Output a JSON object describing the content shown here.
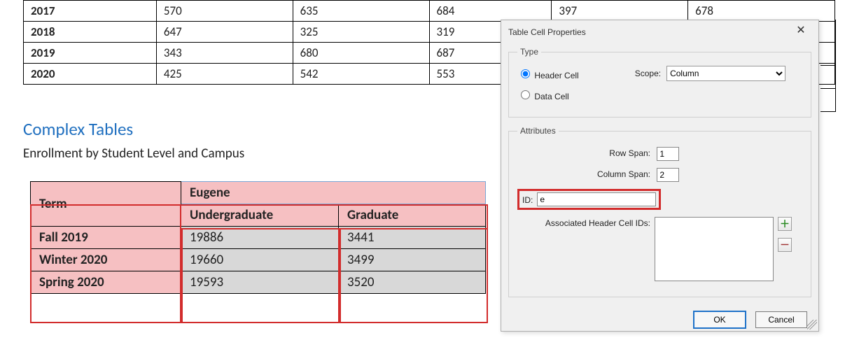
{
  "top_table": {
    "rows": [
      {
        "year": "2017",
        "a": "570",
        "b": "635",
        "c": "684",
        "d": "397",
        "e": "678"
      },
      {
        "year": "2018",
        "a": "647",
        "b": "325",
        "c": "319",
        "d": "",
        "e": ""
      },
      {
        "year": "2019",
        "a": "343",
        "b": "680",
        "c": "687",
        "d": "",
        "e": ""
      },
      {
        "year": "2020",
        "a": "425",
        "b": "542",
        "c": "553",
        "d": "",
        "e": ""
      }
    ]
  },
  "section_title": "Complex Tables",
  "section_caption": "Enrollment by Student Level and Campus",
  "cx_table": {
    "term_header": "Term",
    "campus_header": "Eugene",
    "sub_headers": {
      "ug": "Undergraduate",
      "gr": "Graduate"
    },
    "rows": [
      {
        "term": "Fall 2019",
        "ug": "19886",
        "gr": "3441"
      },
      {
        "term": "Winter 2020",
        "ug": "19660",
        "gr": "3499"
      },
      {
        "term": "Spring 2020",
        "ug": "19593",
        "gr": "3520"
      }
    ]
  },
  "dialog": {
    "title": "Table Cell Properties",
    "group_type": "Type",
    "group_attrs": "Attributes",
    "radio_header": "Header Cell",
    "radio_data": "Data Cell",
    "scope_label": "Scope:",
    "scope_value": "Column",
    "rowspan_label": "Row Span:",
    "rowspan_value": "1",
    "colspan_label": "Column Span:",
    "colspan_value": "2",
    "id_label": "ID:",
    "id_value": "e",
    "assoc_label": "Associated Header Cell IDs:",
    "assoc_value": "",
    "ok": "OK",
    "cancel": "Cancel",
    "icons": {
      "add": "add-icon",
      "remove": "remove-icon",
      "close": "close-icon"
    }
  }
}
